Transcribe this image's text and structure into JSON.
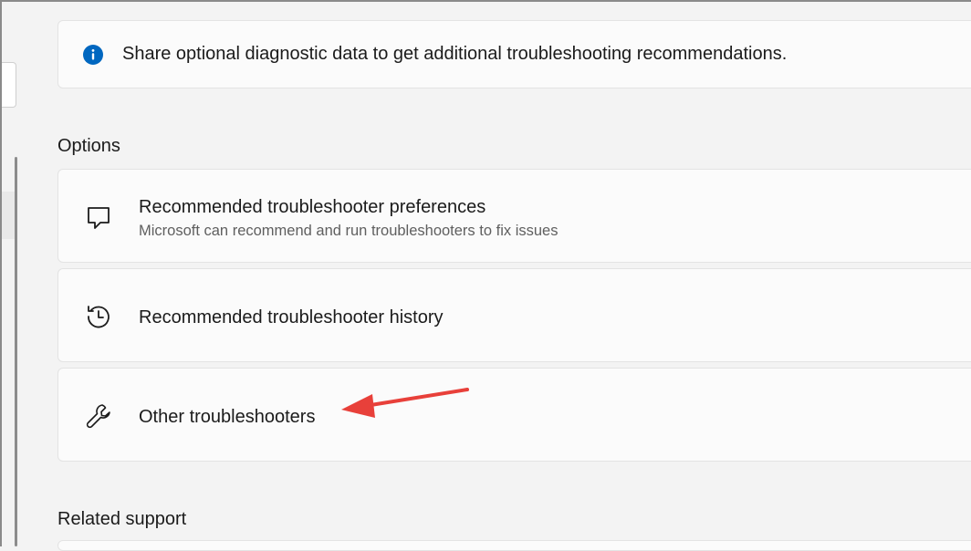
{
  "info_bar": {
    "icon": "info-icon",
    "text": "Share optional diagnostic data to get additional troubleshooting recommendations.",
    "accent": "#0067c0"
  },
  "options": {
    "title": "Options",
    "items": [
      {
        "icon": "chat-bubble-icon",
        "title": "Recommended troubleshooter preferences",
        "subtitle": "Microsoft can recommend and run troubleshooters to fix issues"
      },
      {
        "icon": "history-icon",
        "title": "Recommended troubleshooter history"
      },
      {
        "icon": "wrench-icon",
        "title": "Other troubleshooters"
      }
    ]
  },
  "related_support": {
    "title": "Related support"
  },
  "annotation": {
    "arrow_color": "#e8403a"
  }
}
